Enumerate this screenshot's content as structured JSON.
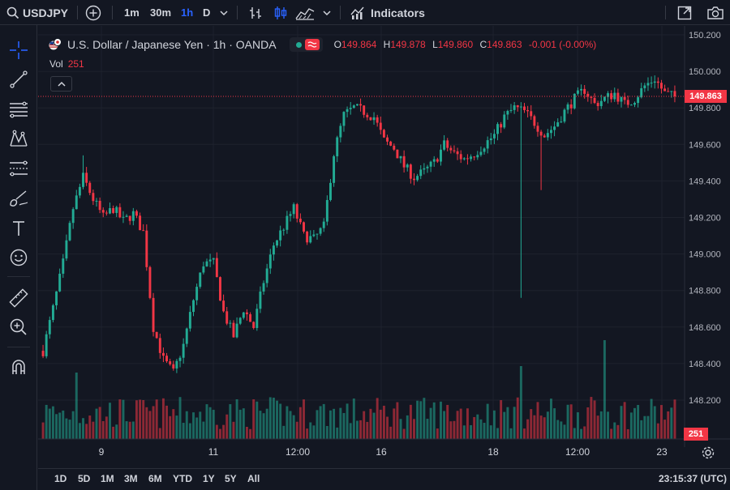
{
  "toolbar": {
    "symbol": "USDJPY",
    "timeframes": [
      "1m",
      "30m",
      "1h",
      "D"
    ],
    "active_timeframe": "1h",
    "indicators_label": "Indicators"
  },
  "legend": {
    "title": "U.S. Dollar / Japanese Yen · 1h · OANDA",
    "ohlc": [
      {
        "k": "O",
        "v": "149.864"
      },
      {
        "k": "H",
        "v": "149.878"
      },
      {
        "k": "L",
        "v": "149.860"
      },
      {
        "k": "C",
        "v": "149.863"
      }
    ],
    "change": "-0.001 (-0.00%)",
    "vol_label": "Vol",
    "vol_value": "251"
  },
  "price_axis": {
    "labels": [
      "150.200",
      "150.000",
      "149.800",
      "149.600",
      "149.400",
      "149.200",
      "149.000",
      "148.800",
      "148.600",
      "148.400",
      "148.200"
    ],
    "current_price": "149.863",
    "current_volume": "251"
  },
  "time_axis": {
    "labels": [
      "9",
      "11",
      "12:00",
      "16",
      "18",
      "12:00",
      "23"
    ]
  },
  "ranges": [
    "1D",
    "5D",
    "1M",
    "3M",
    "6M",
    "YTD",
    "1Y",
    "5Y",
    "All"
  ],
  "clock": "23:15:37 (UTC)",
  "colors": {
    "up": "#22ab94",
    "down": "#f23645",
    "accent": "#2962ff",
    "bg": "#131722"
  },
  "chart_data": {
    "type": "candlestick",
    "symbol": "USDJPY",
    "interval": "1h",
    "ylim": [
      148.0,
      150.22
    ],
    "price_ticks": [
      148.2,
      148.4,
      148.6,
      148.8,
      149.0,
      149.2,
      149.4,
      149.6,
      149.8,
      150.0,
      150.2
    ],
    "current_price": 149.863,
    "series": [
      {
        "name": "price_path",
        "values": [
          148.47,
          148.7,
          148.95,
          149.25,
          149.42,
          149.3,
          149.2,
          149.25,
          149.18,
          149.22,
          149.12,
          148.6,
          148.42,
          148.35,
          148.5,
          148.75,
          148.95,
          148.95,
          148.68,
          148.55,
          148.7,
          148.6,
          148.85,
          149.05,
          149.15,
          149.25,
          149.1,
          149.08,
          149.15,
          149.55,
          149.76,
          149.8,
          149.78,
          149.75,
          149.62,
          149.58,
          149.48,
          149.42,
          149.45,
          149.5,
          149.6,
          149.55,
          149.52,
          149.55,
          149.6,
          149.65,
          149.75,
          149.8,
          149.78,
          149.72,
          149.65,
          149.7,
          149.78,
          149.85,
          149.9,
          149.82,
          149.85,
          149.88,
          149.82,
          149.85,
          149.92,
          149.96,
          149.88,
          149.86
        ]
      }
    ]
  }
}
